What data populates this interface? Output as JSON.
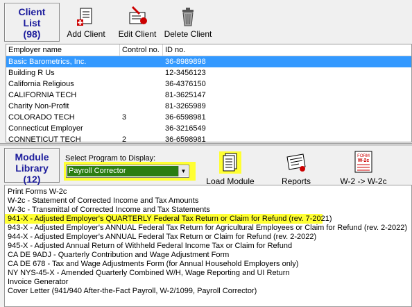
{
  "client_panel": {
    "title_line1": "Client",
    "title_line2": "List",
    "count": "(98)",
    "toolbar": {
      "add_label": "Add Client",
      "edit_label": "Edit Client",
      "delete_label": "Delete Client"
    },
    "columns": [
      "Employer name",
      "Control no.",
      "ID no."
    ],
    "rows": [
      {
        "name": "Basic Barometrics, Inc.",
        "control": "",
        "id": "36-8989898",
        "selected": true
      },
      {
        "name": "Building R Us",
        "control": "",
        "id": "12-3456123"
      },
      {
        "name": "California Religious",
        "control": "",
        "id": "36-4376150"
      },
      {
        "name": "CALIFORNIA TECH",
        "control": "",
        "id": "81-3625147"
      },
      {
        "name": "Charity Non-Profit",
        "control": "",
        "id": "81-3265989"
      },
      {
        "name": "COLORADO TECH",
        "control": "3",
        "id": "36-6598981"
      },
      {
        "name": "Connecticut Employer",
        "control": "",
        "id": "36-3216549"
      },
      {
        "name": "CONNETICUT TECH",
        "control": "2",
        "id": "36-6598981"
      }
    ]
  },
  "module_panel": {
    "title_line1": "Module",
    "title_line2": "Library",
    "count": "(12)",
    "select_label": "Select Program to Display:",
    "selected_program": "Payroll Corrector",
    "toolbar": {
      "load_label": "Load Module",
      "reports_label": "Reports",
      "w2_label": "W-2 -> W-2c",
      "w2_icon_text1": "FORM",
      "w2_icon_text2": "W-2c"
    },
    "items": [
      "Print Forms W-2c",
      "W-2c - Statement of Corrected Income and Tax Amounts",
      "W-3c - Transmittal of Corrected Income and Tax Statements",
      "941-X - Adjusted Employer's QUARTERLY Federal Tax Return or Claim for Refund (rev. 7-2021)",
      "943-X - Adjusted Employer's ANNUAL Federal Tax Return for Agricultural Employees or Claim for Refund (rev. 2-2022)",
      "944-X - Adjusted Employer's ANNUAL Federal Tax Return or Claim for Refund (rev. 2-2022)",
      "945-X - Adjusted Annual Return of Withheld Federal Income Tax or Claim for Refund",
      "CA DE 9ADJ - Quarterly Contribution and Wage Adjustment Form",
      "CA DE 678 - Tax and Wage Adjustments Form (for Annual Household Employers only)",
      "NY NYS-45-X - Amended Quarterly Combined W/H, Wage Reporting and UI Return",
      "Invoice Generator",
      "Cover Letter (941/940 After-the-Fact Payroll, W-2/1099, Payroll Corrector)"
    ]
  },
  "colors": {
    "title_blue": "#1c1c9c",
    "selection_blue": "#3399ff",
    "highlight_yellow": "#ffff33",
    "combo_green": "#2a7d12"
  }
}
